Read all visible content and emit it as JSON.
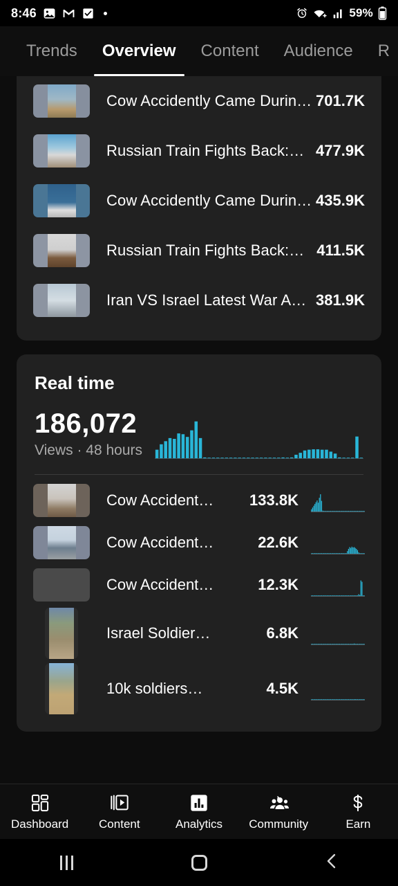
{
  "statusbar": {
    "time": "8:46",
    "battery_pct": "59%",
    "icons": [
      "photo-icon",
      "gmail-icon",
      "checkbox-icon",
      "dot-icon"
    ],
    "right_icons": [
      "alarm-icon",
      "wifi-icon",
      "signal-icon",
      "battery-icon"
    ]
  },
  "tabs": [
    {
      "label": "Trends",
      "active": false
    },
    {
      "label": "Overview",
      "active": true
    },
    {
      "label": "Content",
      "active": false
    },
    {
      "label": "Audience",
      "active": false
    },
    {
      "label": "R",
      "active": false
    }
  ],
  "top_videos": {
    "rows": [
      {
        "title": "Cow Accidently Came Durin…",
        "views": "701.7K",
        "thumb": "landscape",
        "colors": [
          "#8fa7bd",
          "#c9b28e"
        ]
      },
      {
        "title": "Russian Train Fights Back:…",
        "views": "477.9K",
        "thumb": "landscape",
        "colors": [
          "#79b5d8",
          "#cfcfcf"
        ]
      },
      {
        "title": "Cow Accidently Came Durin…",
        "views": "435.9K",
        "thumb": "landscape",
        "colors": [
          "#3d6f96",
          "#e8e8e8"
        ]
      },
      {
        "title": "Russian Train Fights Back:…",
        "views": "411.5K",
        "thumb": "landscape",
        "colors": [
          "#d9d9d9",
          "#7a5a3c"
        ]
      },
      {
        "title": "Iran VS Israel Latest War A…",
        "views": "381.9K",
        "thumb": "landscape",
        "colors": [
          "#c3d2dd",
          "#9aa6ad"
        ]
      }
    ]
  },
  "realtime": {
    "title": "Real time",
    "value": "186,072",
    "subtitle": "Views · 48 hours",
    "rows": [
      {
        "title": "Cow Accident…",
        "views": "133.8K",
        "thumb": "landscape",
        "colors": [
          "#6b6058",
          "#d5d5d5"
        ]
      },
      {
        "title": "Cow Accident…",
        "views": "22.6K",
        "thumb": "landscape",
        "colors": [
          "#7d8596",
          "#c4cfdb"
        ]
      },
      {
        "title": "Cow Accident…",
        "views": "12.3K",
        "thumb": "blank",
        "colors": [
          "#4a4a4a",
          "#4a4a4a"
        ]
      },
      {
        "title": "Israel Soldier…",
        "views": "6.8K",
        "thumb": "vertical",
        "colors": [
          "#8d9a78",
          "#b9a88c"
        ]
      },
      {
        "title": "10k soldiers…",
        "views": "4.5K",
        "thumb": "vertical",
        "colors": [
          "#8fb6d6",
          "#c9ad76"
        ]
      }
    ]
  },
  "chart_data": [
    {
      "type": "bar",
      "name": "realtime-views-48h",
      "title": "Views · 48 hours",
      "xlabel": "hour",
      "ylabel": "views",
      "x": [
        1,
        2,
        3,
        4,
        5,
        6,
        7,
        8,
        9,
        10,
        11,
        12,
        13,
        14,
        15,
        16,
        17,
        18,
        19,
        20,
        21,
        22,
        23,
        24,
        25,
        26,
        27,
        28,
        29,
        30,
        31,
        32,
        33,
        34,
        35,
        36,
        37,
        38,
        39,
        40,
        41,
        42,
        43,
        44,
        45,
        46,
        47,
        48
      ],
      "values": [
        22,
        36,
        44,
        52,
        50,
        64,
        62,
        55,
        72,
        95,
        52,
        2,
        1,
        1,
        1,
        1,
        1,
        1,
        1,
        1,
        1,
        1,
        1,
        1,
        1,
        1,
        1,
        1,
        1,
        2,
        1,
        2,
        9,
        14,
        20,
        22,
        23,
        23,
        22,
        22,
        17,
        12,
        2,
        1,
        1,
        1,
        56,
        1
      ],
      "ylim": [
        0,
        100
      ],
      "color": "#29b6d8",
      "grid": false
    },
    {
      "type": "bar",
      "name": "sparkline-row-1",
      "values": [
        10,
        18,
        26,
        34,
        42,
        50,
        40,
        62,
        78,
        48,
        4,
        1,
        1,
        1,
        1,
        1,
        1,
        1,
        1,
        1,
        1,
        1,
        1,
        1,
        1,
        1,
        1,
        1,
        1,
        1,
        1,
        1,
        1,
        1,
        1,
        1,
        1,
        1,
        1,
        1,
        1,
        1,
        1,
        1,
        1,
        1,
        1,
        1
      ],
      "ylim": [
        0,
        100
      ],
      "color": "#29b6d8"
    },
    {
      "type": "bar",
      "name": "sparkline-row-2",
      "values": [
        1,
        1,
        1,
        1,
        1,
        1,
        1,
        1,
        1,
        1,
        1,
        1,
        1,
        1,
        1,
        1,
        1,
        1,
        1,
        1,
        1,
        1,
        1,
        1,
        1,
        1,
        1,
        1,
        1,
        1,
        1,
        1,
        12,
        22,
        30,
        26,
        32,
        28,
        30,
        26,
        22,
        16,
        6,
        2,
        1,
        1,
        1,
        1
      ],
      "ylim": [
        0,
        100
      ],
      "color": "#29b6d8"
    },
    {
      "type": "bar",
      "name": "sparkline-row-3",
      "values": [
        1,
        1,
        1,
        1,
        1,
        1,
        1,
        1,
        1,
        1,
        1,
        1,
        1,
        1,
        1,
        1,
        1,
        1,
        1,
        1,
        1,
        1,
        1,
        1,
        1,
        1,
        1,
        1,
        1,
        1,
        1,
        1,
        1,
        1,
        1,
        1,
        1,
        1,
        1,
        1,
        1,
        1,
        8,
        4,
        70,
        64,
        2,
        1
      ],
      "ylim": [
        0,
        100
      ],
      "color": "#29b6d8"
    },
    {
      "type": "bar",
      "name": "sparkline-row-4",
      "values": [
        1,
        1,
        1,
        1,
        1,
        1,
        1,
        1,
        1,
        1,
        1,
        1,
        1,
        1,
        1,
        1,
        1,
        1,
        1,
        1,
        1,
        1,
        1,
        1,
        1,
        1,
        1,
        1,
        1,
        1,
        1,
        1,
        1,
        1,
        1,
        1,
        1,
        1,
        4,
        1,
        1,
        1,
        1,
        1,
        1,
        1,
        1,
        1
      ],
      "ylim": [
        0,
        100
      ],
      "color": "#29b6d8"
    },
    {
      "type": "bar",
      "name": "sparkline-row-5",
      "values": [
        1,
        1,
        1,
        1,
        1,
        1,
        1,
        1,
        1,
        1,
        1,
        1,
        1,
        1,
        1,
        1,
        1,
        1,
        1,
        1,
        1,
        1,
        1,
        1,
        1,
        1,
        1,
        1,
        1,
        1,
        1,
        1,
        1,
        1,
        1,
        1,
        1,
        1,
        1,
        3,
        1,
        1,
        1,
        1,
        1,
        1,
        1,
        1
      ],
      "ylim": [
        0,
        100
      ],
      "color": "#29b6d8"
    }
  ],
  "bottom_nav": [
    {
      "label": "Dashboard",
      "icon": "grid-icon",
      "active": false
    },
    {
      "label": "Content",
      "icon": "video-stack-icon",
      "active": false
    },
    {
      "label": "Analytics",
      "icon": "bar-chart-icon",
      "active": true
    },
    {
      "label": "Community",
      "icon": "people-icon",
      "active": false
    },
    {
      "label": "Earn",
      "icon": "dollar-icon",
      "active": false
    }
  ],
  "android_nav": [
    {
      "name": "recents-button",
      "icon": "three-bars-icon"
    },
    {
      "name": "home-button",
      "icon": "circle-icon"
    },
    {
      "name": "back-button",
      "icon": "chevron-left-icon"
    }
  ],
  "colors": {
    "accent": "#29b6d8",
    "card": "#212121",
    "page": "#0d0d0d"
  }
}
